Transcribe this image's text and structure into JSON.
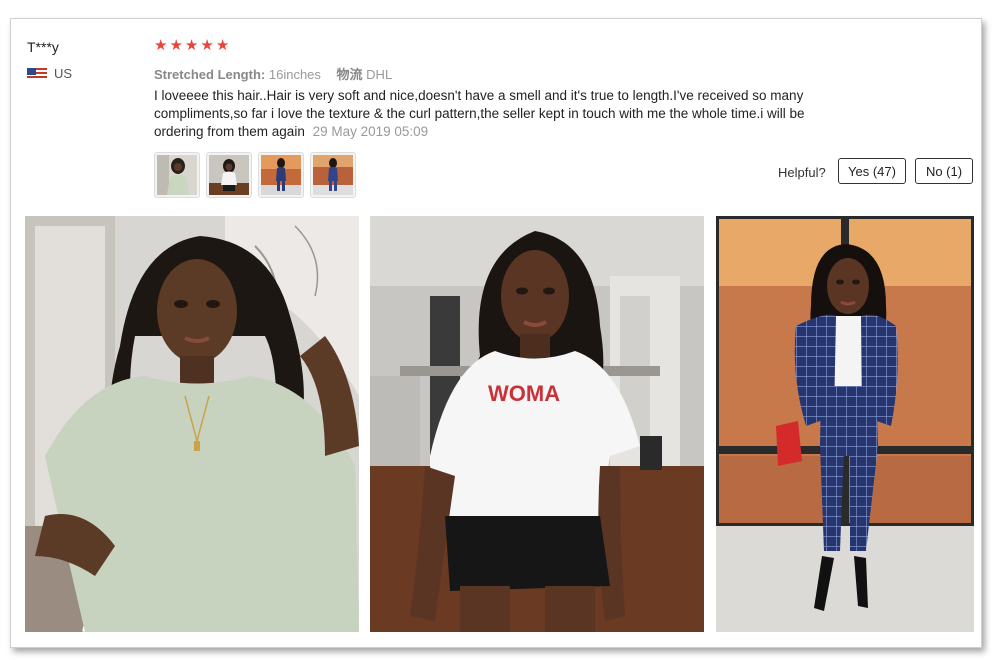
{
  "review": {
    "user_name": "T***y",
    "country_code": "US",
    "rating": 5,
    "stars": [
      "★",
      "★",
      "★",
      "★",
      "★"
    ],
    "star_color": "#e8453c",
    "attributes": {
      "length_label": "Stretched Length:",
      "length_value": "16inches",
      "shipping_label": "物流",
      "shipping_value": "DHL"
    },
    "text": "I loveeee this hair..Hair is very soft and nice,doesn't have a smell and it's true to length.I've received so many compliments,so far i love the texture & the curl pattern,the seller kept in touch with me the whole time.i will be ordering from them again",
    "date": "29 May 2019 05:09",
    "thumbnail_icons": [
      "photo-thumbnail-1",
      "photo-thumbnail-2",
      "photo-thumbnail-3",
      "photo-thumbnail-4"
    ],
    "helpful": {
      "label": "Helpful?",
      "yes_label": "Yes (47)",
      "no_label": "No (1)"
    },
    "photos": [
      {
        "icon": "review-photo-green-tshirt"
      },
      {
        "icon": "review-photo-white-tshirt",
        "shirt_text": "WOMA"
      },
      {
        "icon": "review-photo-plaid-suit"
      }
    ]
  }
}
